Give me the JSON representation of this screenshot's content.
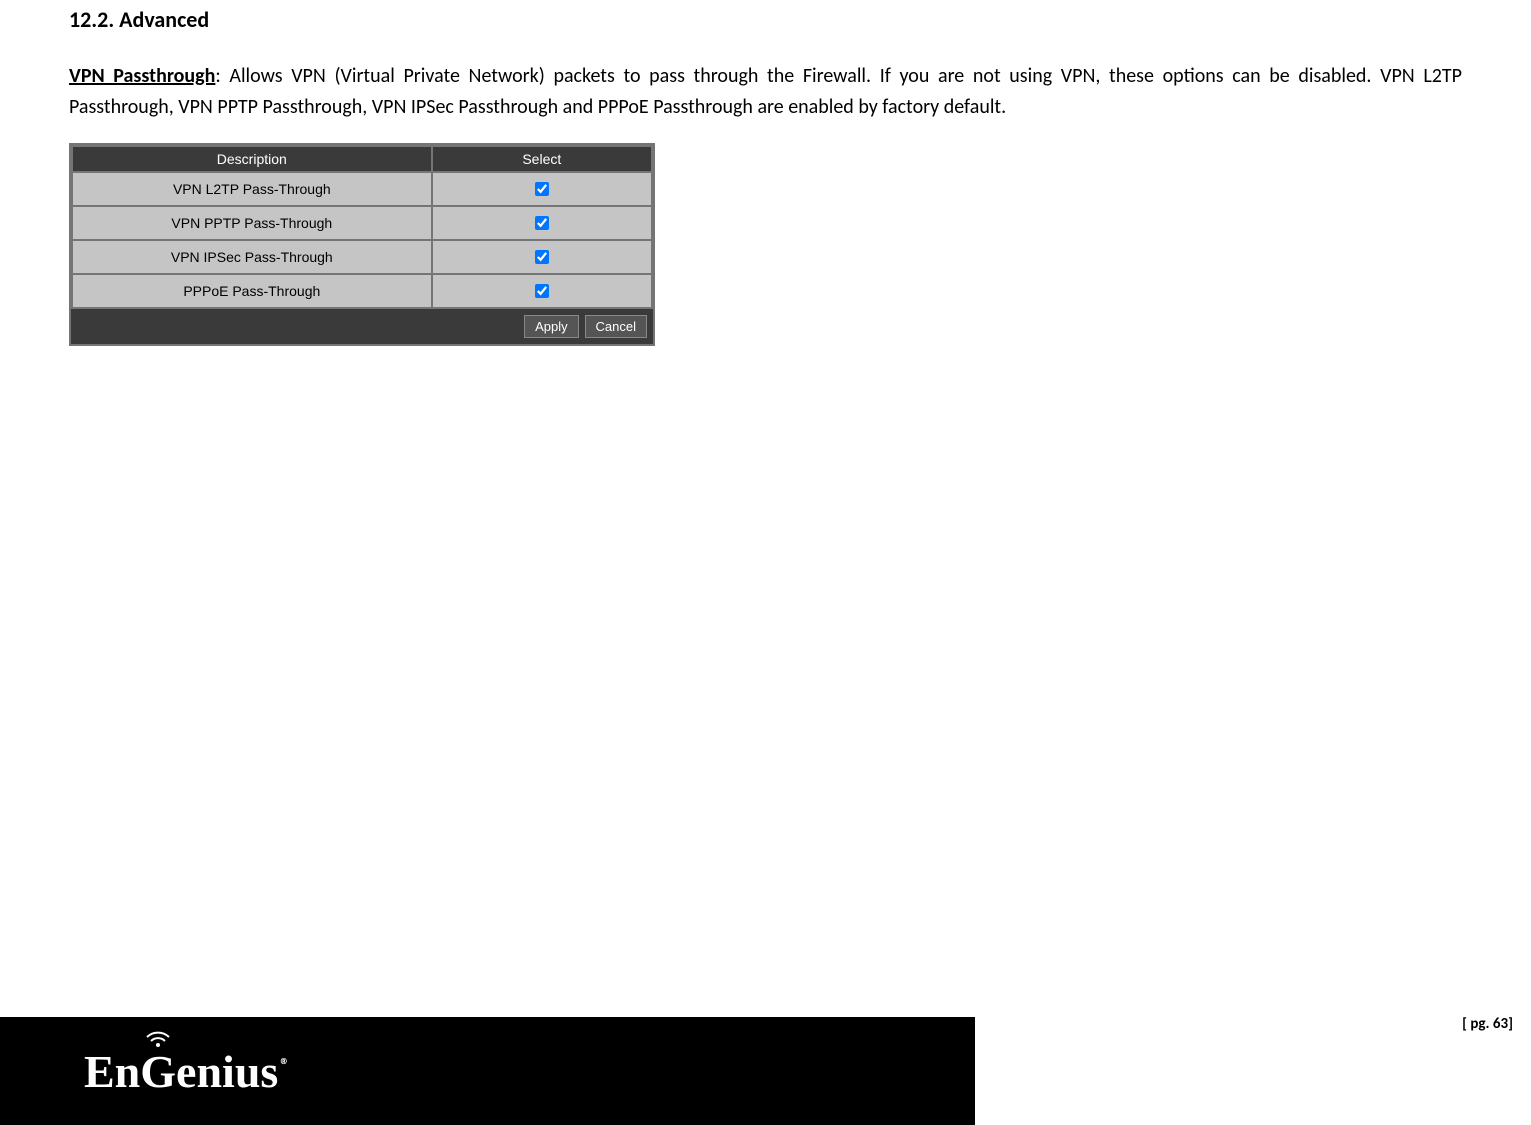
{
  "section_title": "12.2.  Advanced",
  "paragraph_lead": "VPN Passthrough",
  "paragraph_rest": ": Allows VPN (Virtual Private Network) packets to pass through the Firewall. If you are not using VPN, these options can be disabled. VPN L2TP Passthrough, VPN PPTP Passthrough, VPN IPSec Passthrough and PPPoE Passthrough are enabled by factory default.",
  "table": {
    "headers": {
      "description": "Description",
      "select": "Select"
    },
    "rows": [
      {
        "description": "VPN L2TP Pass-Through",
        "checked": true
      },
      {
        "description": "VPN PPTP Pass-Through",
        "checked": true
      },
      {
        "description": "VPN IPSec Pass-Through",
        "checked": true
      },
      {
        "description": "PPPoE Pass-Through",
        "checked": true
      }
    ],
    "apply_label": "Apply",
    "cancel_label": "Cancel"
  },
  "footer": {
    "logo_text": "EnGenius",
    "page_label": "[ pg. 63]"
  }
}
